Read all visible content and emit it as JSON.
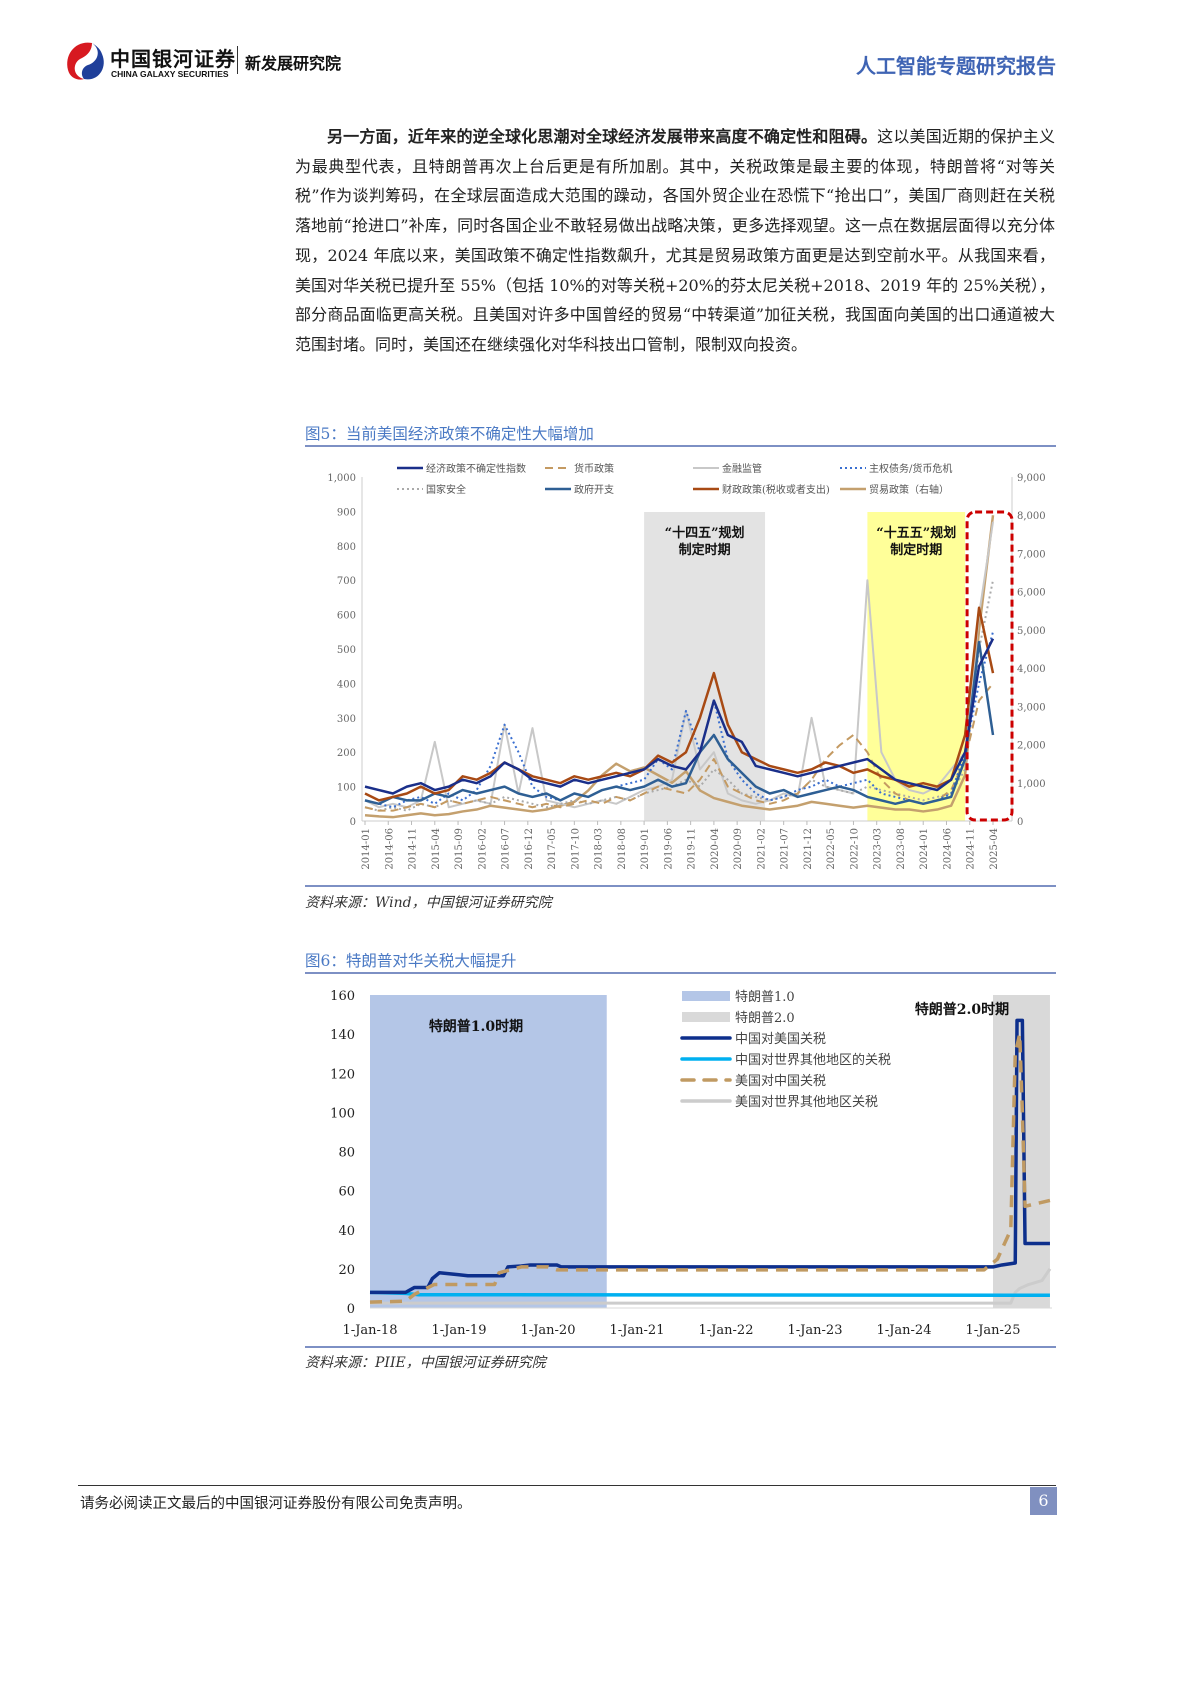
{
  "header": {
    "logo_cn": "中国银河证券",
    "logo_en": "CHINA GALAXY SECURITIES",
    "institute": "新发展研究院",
    "report_type": "人工智能专题研究报告"
  },
  "body": {
    "paragraph_bold": "另一方面，近年来的逆全球化思潮对全球经济发展带来高度不确定性和阻碍。",
    "paragraph_rest": "这以美国近期的保护主义为最典型代表，且特朗普再次上台后更是有所加剧。其中，关税政策是最主要的体现，特朗普将“对等关税”作为谈判筹码，在全球层面造成大范围的躁动，各国外贸企业在恐慌下“抢出口”，美国厂商则赶在关税落地前“抢进口”补库，同时各国企业不敢轻易做出战略决策，更多选择观望。这一点在数据层面得以充分体现，2024 年底以来，美国政策不确定性指数飙升，尤其是贸易政策方面更是达到空前水平。从我国来看，美国对华关税已提升至 55%（包括 10%的对等关税+20%的芬太尼关税+2018、2019 年的 25%关税），部分商品面临更高关税。且美国对许多中国曾经的贸易“中转渠道”加征关税，我国面向美国的出口通道被大范围封堵。同时，美国还在继续强化对华科技出口管制，限制双向投资。"
  },
  "figure5": {
    "title": "图5：当前美国经济政策不确定性大幅增加",
    "source": "资料来源：Wind，中国银河证券研究院"
  },
  "figure6": {
    "title": "图6：特朗普对华关税大幅提升",
    "source": "资料来源：PIIE，中国银河证券研究院"
  },
  "footer": {
    "disclaimer": "请务必阅读正文最后的中国银河证券股份有限公司免责声明。",
    "page_number": "6"
  },
  "chart_data": [
    {
      "type": "line",
      "title": "当前美国经济政策不确定性大幅增加",
      "x_start": "2014-01",
      "x_step_months": 3,
      "x_tick_labels": [
        "2014-01",
        "2014-06",
        "2014-11",
        "2015-04",
        "2015-09",
        "2016-02",
        "2016-07",
        "2016-12",
        "2017-05",
        "2017-10",
        "2018-03",
        "2018-08",
        "2019-01",
        "2019-06",
        "2019-11",
        "2020-04",
        "2020-09",
        "2021-02",
        "2021-07",
        "2021-12",
        "2022-05",
        "2022-10",
        "2023-03",
        "2023-08",
        "2024-01",
        "2024-06",
        "2024-11",
        "2025-04"
      ],
      "ylim_left": [
        0,
        1000
      ],
      "y_ticks_left": [
        "0",
        "100",
        "200",
        "300",
        "400",
        "500",
        "600",
        "700",
        "800",
        "900",
        "1,000"
      ],
      "ylim_right": [
        0,
        9000
      ],
      "y_ticks_right": [
        "0",
        "1,000",
        "2,000",
        "3,000",
        "4,000",
        "5,000",
        "6,000",
        "7,000",
        "8,000",
        "9,000"
      ],
      "shaded_periods": [
        {
          "label": "“十四五”规划制定时期",
          "line1": "“十四五”规划",
          "line2": "制定时期",
          "from": "2019-01",
          "to": "2021-03",
          "color": "#e3e3e3"
        },
        {
          "label": "“十五五”规划制定时期",
          "line1": "“十五五”规划",
          "line2": "制定时期",
          "from": "2023-01",
          "to": "2024-10",
          "color": "#ffff99"
        }
      ],
      "highlight_box": {
        "from": "2024-10",
        "to": "2025-06",
        "color": "#cc0000"
      },
      "series": [
        {
          "name": "经济政策不确定性指数",
          "axis": "left",
          "color": "#1a2f8a",
          "style": "solid",
          "width": 2.5,
          "values": [
            100,
            90,
            80,
            100,
            110,
            90,
            100,
            120,
            110,
            130,
            170,
            150,
            120,
            110,
            100,
            120,
            110,
            120,
            130,
            140,
            150,
            180,
            160,
            150,
            200,
            350,
            250,
            230,
            160,
            150,
            140,
            130,
            140,
            150,
            160,
            170,
            180,
            150,
            120,
            110,
            100,
            90,
            120,
            200,
            450,
            530
          ]
        },
        {
          "name": "货币政策",
          "axis": "left",
          "color": "#c49a62",
          "style": "dash",
          "width": 2,
          "values": [
            40,
            30,
            30,
            40,
            50,
            40,
            60,
            50,
            60,
            70,
            60,
            50,
            40,
            50,
            40,
            50,
            60,
            50,
            70,
            60,
            80,
            100,
            90,
            80,
            120,
            180,
            100,
            80,
            60,
            50,
            60,
            80,
            120,
            180,
            220,
            250,
            200,
            120,
            80,
            60,
            50,
            60,
            90,
            180,
            350,
            400
          ]
        },
        {
          "name": "金融监管",
          "axis": "left",
          "color": "#c8c8c8",
          "style": "solid",
          "width": 2,
          "values": [
            60,
            40,
            50,
            40,
            60,
            230,
            40,
            50,
            60,
            50,
            280,
            80,
            270,
            60,
            50,
            40,
            50,
            60,
            50,
            70,
            90,
            100,
            120,
            320,
            150,
            200,
            80,
            60,
            50,
            60,
            80,
            70,
            300,
            100,
            90,
            80,
            700,
            200,
            120,
            90,
            80,
            100,
            150,
            200,
            600,
            870
          ]
        },
        {
          "name": "主权债务/货币危机",
          "axis": "left",
          "color": "#3a6fd0",
          "style": "dot",
          "width": 2,
          "values": [
            60,
            50,
            40,
            60,
            70,
            50,
            80,
            60,
            90,
            160,
            280,
            200,
            100,
            70,
            60,
            80,
            70,
            90,
            100,
            110,
            120,
            180,
            150,
            320,
            200,
            350,
            180,
            120,
            80,
            60,
            70,
            90,
            100,
            120,
            100,
            110,
            120,
            80,
            70,
            60,
            50,
            60,
            80,
            200,
            400,
            550
          ]
        },
        {
          "name": "国家安全",
          "axis": "left",
          "color": "#aaaaaa",
          "style": "dot",
          "width": 2,
          "values": [
            40,
            30,
            40,
            30,
            50,
            40,
            60,
            50,
            60,
            50,
            70,
            60,
            50,
            40,
            50,
            60,
            50,
            60,
            70,
            60,
            80,
            90,
            100,
            120,
            100,
            150,
            120,
            80,
            70,
            60,
            70,
            80,
            120,
            100,
            90,
            80,
            100,
            90,
            80,
            70,
            60,
            70,
            80,
            150,
            500,
            700
          ]
        },
        {
          "name": "政府开支",
          "axis": "left",
          "color": "#2e5f94",
          "style": "solid",
          "width": 2.5,
          "values": [
            60,
            50,
            70,
            60,
            60,
            80,
            70,
            90,
            80,
            90,
            100,
            80,
            70,
            80,
            60,
            80,
            70,
            90,
            100,
            90,
            100,
            120,
            100,
            110,
            200,
            250,
            180,
            140,
            100,
            80,
            90,
            70,
            80,
            90,
            100,
            90,
            70,
            60,
            50,
            60,
            50,
            60,
            70,
            180,
            520,
            250
          ]
        },
        {
          "name": "财政政策(税收或者支出)",
          "axis": "left",
          "color": "#a84a14",
          "style": "solid",
          "width": 2.5,
          "values": [
            80,
            60,
            70,
            80,
            100,
            80,
            90,
            130,
            120,
            140,
            170,
            150,
            130,
            120,
            110,
            130,
            120,
            130,
            140,
            130,
            150,
            190,
            170,
            200,
            300,
            430,
            280,
            200,
            180,
            160,
            150,
            140,
            150,
            170,
            160,
            140,
            150,
            130,
            120,
            100,
            110,
            100,
            120,
            250,
            620,
            430
          ]
        },
        {
          "name": "贸易政策（右轴）",
          "axis": "right",
          "color": "#c4a06e",
          "style": "solid",
          "width": 2.5,
          "values": [
            150,
            120,
            100,
            150,
            200,
            150,
            180,
            250,
            300,
            400,
            350,
            300,
            250,
            300,
            400,
            500,
            800,
            1200,
            1500,
            1300,
            1400,
            1200,
            1000,
            1300,
            800,
            600,
            500,
            400,
            350,
            300,
            350,
            400,
            500,
            450,
            400,
            350,
            400,
            350,
            300,
            300,
            250,
            300,
            400,
            1200,
            5000,
            8000
          ]
        }
      ]
    },
    {
      "type": "line",
      "title": "特朗普对华关税大幅提升",
      "x_tick_labels": [
        "1-Jan-18",
        "1-Jan-19",
        "1-Jan-20",
        "1-Jan-21",
        "1-Jan-22",
        "1-Jan-23",
        "1-Jan-24",
        "1-Jan-25"
      ],
      "xlim_year": [
        2018,
        2025.65
      ],
      "ylim": [
        0,
        160
      ],
      "y_ticks": [
        "0",
        "20",
        "40",
        "60",
        "80",
        "100",
        "120",
        "140",
        "160"
      ],
      "shaded_periods": [
        {
          "name": "特朗普1.0",
          "annotation": "特朗普1.0时期",
          "from": 2018.0,
          "to": 2020.66,
          "color": "#b4c6e7"
        },
        {
          "name": "特朗普2.0",
          "annotation": "特朗普2.0时期",
          "from": 2025.0,
          "to": 2025.64,
          "color": "#d9d9d9"
        }
      ],
      "series": [
        {
          "name": "中国对美国关税",
          "color": "#0d2f8c",
          "style": "solid",
          "width": 3.5,
          "points": [
            [
              2018.0,
              8
            ],
            [
              2018.4,
              8
            ],
            [
              2018.5,
              10.5
            ],
            [
              2018.65,
              10.5
            ],
            [
              2018.7,
              15
            ],
            [
              2018.78,
              18
            ],
            [
              2019.0,
              17
            ],
            [
              2019.1,
              16.5
            ],
            [
              2019.5,
              16.5
            ],
            [
              2019.55,
              21
            ],
            [
              2019.7,
              21.5
            ],
            [
              2019.8,
              22
            ],
            [
              2020.1,
              22
            ],
            [
              2020.15,
              21
            ],
            [
              2025.0,
              21
            ],
            [
              2025.1,
              22
            ],
            [
              2025.25,
              23
            ],
            [
              2025.27,
              147
            ],
            [
              2025.33,
              147
            ],
            [
              2025.36,
              33
            ],
            [
              2025.64,
              33
            ]
          ]
        },
        {
          "name": "中国对世界其他地区的关税",
          "color": "#00b0f0",
          "style": "solid",
          "width": 3.5,
          "points": [
            [
              2018.0,
              8
            ],
            [
              2018.4,
              7.5
            ],
            [
              2018.55,
              6.8
            ],
            [
              2025.64,
              6.5
            ]
          ]
        },
        {
          "name": "美国对中国关税",
          "color": "#c09a62",
          "style": "dash",
          "width": 3.5,
          "points": [
            [
              2018.0,
              3
            ],
            [
              2018.4,
              3.5
            ],
            [
              2018.5,
              7
            ],
            [
              2018.72,
              12
            ],
            [
              2019.4,
              12
            ],
            [
              2019.45,
              18
            ],
            [
              2019.7,
              21
            ],
            [
              2020.0,
              21
            ],
            [
              2020.1,
              19.5
            ],
            [
              2024.9,
              19.5
            ],
            [
              2025.05,
              25
            ],
            [
              2025.2,
              40
            ],
            [
              2025.25,
              130
            ],
            [
              2025.3,
              140
            ],
            [
              2025.33,
              100
            ],
            [
              2025.36,
              52
            ],
            [
              2025.64,
              55
            ]
          ]
        },
        {
          "name": "美国对世界其他地区关税",
          "color": "#cccccc",
          "style": "solid",
          "width": 3,
          "points": [
            [
              2018.0,
              2.5
            ],
            [
              2025.2,
              2.5
            ],
            [
              2025.25,
              8
            ],
            [
              2025.3,
              10
            ],
            [
              2025.4,
              12
            ],
            [
              2025.55,
              14
            ],
            [
              2025.64,
              20
            ]
          ]
        }
      ]
    }
  ]
}
